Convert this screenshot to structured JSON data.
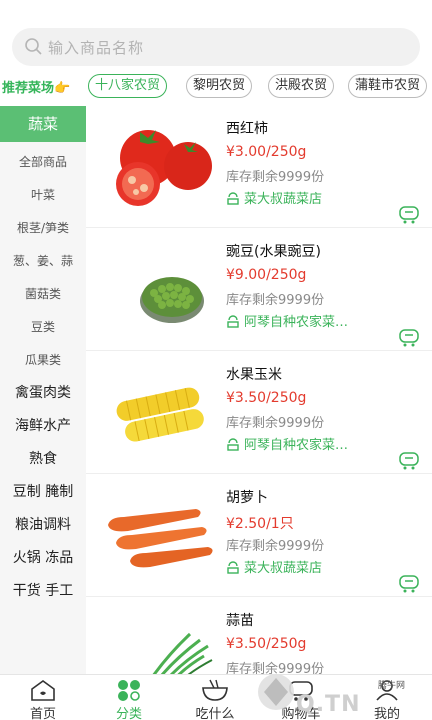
{
  "search": {
    "placeholder": "输入商品名称"
  },
  "markets": {
    "label": "推荐菜场👉",
    "items": [
      "十八家农贸",
      "黎明农贸",
      "洪殿农贸",
      "蒲鞋市农贸"
    ]
  },
  "sidebar": {
    "items": [
      "蔬菜",
      "全部商品",
      "叶菜",
      "根茎/笋类",
      "葱、姜、蒜",
      "菌菇类",
      "豆类",
      "瓜果类",
      "禽蛋肉类",
      "海鲜水产",
      "熟食",
      "豆制 腌制",
      "粮油调料",
      "火锅 冻品",
      "干货 手工"
    ]
  },
  "products": [
    {
      "name": "西红柿",
      "price": "¥3.00/250g",
      "stock": "库存剩余9999份",
      "shop": "菜大叔蔬菜店"
    },
    {
      "name": "豌豆(水果豌豆)",
      "price": "¥9.00/250g",
      "stock": "库存剩余9999份",
      "shop": "阿琴自种农家菜…"
    },
    {
      "name": "水果玉米",
      "price": "¥3.50/250g",
      "stock": "库存剩余9999份",
      "shop": "阿琴自种农家菜…"
    },
    {
      "name": "胡萝卜",
      "price": "¥2.50/1只",
      "stock": "库存剩余9999份",
      "shop": "菜大叔蔬菜店"
    },
    {
      "name": "蒜苗",
      "price": "¥3.50/250g",
      "stock": "库存剩余9999份",
      "shop": ""
    }
  ],
  "tabbar": {
    "items": [
      "首页",
      "分类",
      "吃什么",
      "购物车",
      "我的"
    ]
  },
  "watermark": {
    "brand": "Q.TN",
    "small": "腾牛网"
  },
  "colors": {
    "accent": "#3bb35a",
    "price": "#e33b2e",
    "sidebar_active": "#5bbf74"
  }
}
